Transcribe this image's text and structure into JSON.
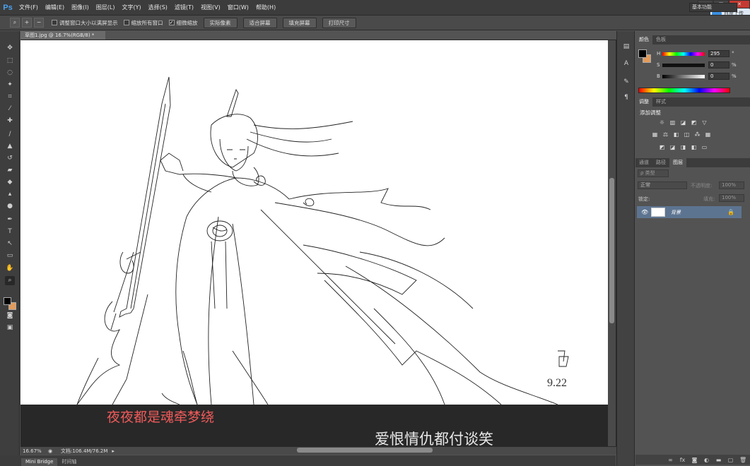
{
  "app": {
    "logo": "Ps",
    "menu": [
      "文件(F)",
      "编辑(E)",
      "图像(I)",
      "图层(L)",
      "文字(Y)",
      "选择(S)",
      "滤镜(T)",
      "视图(V)",
      "窗口(W)",
      "帮助(H)"
    ],
    "window_buttons": [
      "—",
      "□",
      "✕"
    ],
    "cloud_badge": "百度上传"
  },
  "options_bar": {
    "checkbox1": "调整窗口大小以满屏显示",
    "checkbox2": "缩放所有窗口",
    "checkbox3": "细微缩放",
    "button1": "实际像素",
    "button2": "适合屏幕",
    "button3": "填充屏幕",
    "button4": "打印尺寸",
    "workspace": "基本功能"
  },
  "document": {
    "tab_title": "草图1.jpg @ 16.7%(RGB/8) *",
    "zoom": "16.67%",
    "doc_size": "文档:106.4M/76.2M",
    "signature_text": "9.22"
  },
  "overlay": {
    "subtitle_line1": "夜夜都是魂牵梦绕",
    "subtitle_line2": "爱恨情仇都付谈笑"
  },
  "bottom_tabs": [
    "Mini Bridge",
    "时间轴"
  ],
  "color_panel": {
    "tabs": [
      "颜色",
      "色板"
    ],
    "H": {
      "label": "H",
      "value": "295",
      "unit": "°"
    },
    "S": {
      "label": "S",
      "value": "0",
      "unit": "%"
    },
    "B": {
      "label": "B",
      "value": "0",
      "unit": "%"
    },
    "foreground": "#000000",
    "background": "#e39b5b"
  },
  "adjust_panel": {
    "tabs": [
      "调整",
      "样式"
    ],
    "title": "添加调整"
  },
  "layers_panel": {
    "tabs": [
      "通道",
      "路径",
      "图层"
    ],
    "kind_filter": "ρ 类型",
    "blend_mode": "正常",
    "opacity_label": "不透明度:",
    "opacity_value": "100%",
    "lock_label": "锁定:",
    "fill_label": "填充:",
    "fill_value": "100%",
    "layer_name": "背景"
  }
}
